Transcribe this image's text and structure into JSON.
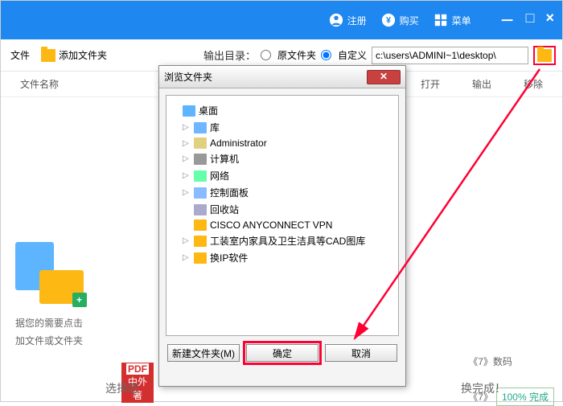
{
  "titlebar": {
    "register": "注册",
    "buy": "购买",
    "menu": "菜单"
  },
  "toolbar": {
    "add_folder": "添加文件夹",
    "file_label": "文件",
    "output_label": "输出目录：",
    "radio_original": "原文件夹",
    "radio_custom": "自定义",
    "path": "c:\\users\\ADMINI~1\\desktop\\"
  },
  "columns": {
    "name": "文件名称",
    "open": "打开",
    "output": "输出",
    "remove": "移除"
  },
  "hints": {
    "line1": "据您的需要点击",
    "line2": "加文件或文件夹",
    "bottom": "选择您",
    "pdf": "中外著",
    "right_bottom": "换完成！"
  },
  "right": {
    "item1": "《7》数码",
    "item2": "《7》",
    "percent": "100%",
    "done": "完成"
  },
  "dialog": {
    "title": "浏览文件夹",
    "new_folder": "新建文件夹(M)",
    "ok": "确定",
    "cancel": "取消",
    "tree": [
      {
        "label": "桌面",
        "cls": "desktop",
        "lvl": 0
      },
      {
        "label": "库",
        "cls": "lib",
        "lvl": 1,
        "arw": "▷"
      },
      {
        "label": "Administrator",
        "cls": "user",
        "lvl": 1,
        "arw": "▷"
      },
      {
        "label": "计算机",
        "cls": "pc",
        "lvl": 1,
        "arw": "▷"
      },
      {
        "label": "网络",
        "cls": "net",
        "lvl": 1,
        "arw": "▷"
      },
      {
        "label": "控制面板",
        "cls": "cp",
        "lvl": 1,
        "arw": "▷"
      },
      {
        "label": "回收站",
        "cls": "bin",
        "lvl": 1,
        "arw": ""
      },
      {
        "label": "CISCO ANYCONNECT VPN",
        "cls": "",
        "lvl": 1,
        "arw": ""
      },
      {
        "label": "工装室内家具及卫生洁具等CAD图库",
        "cls": "",
        "lvl": 1,
        "arw": "▷"
      },
      {
        "label": "换IP软件",
        "cls": "",
        "lvl": 1,
        "arw": "▷"
      }
    ]
  }
}
